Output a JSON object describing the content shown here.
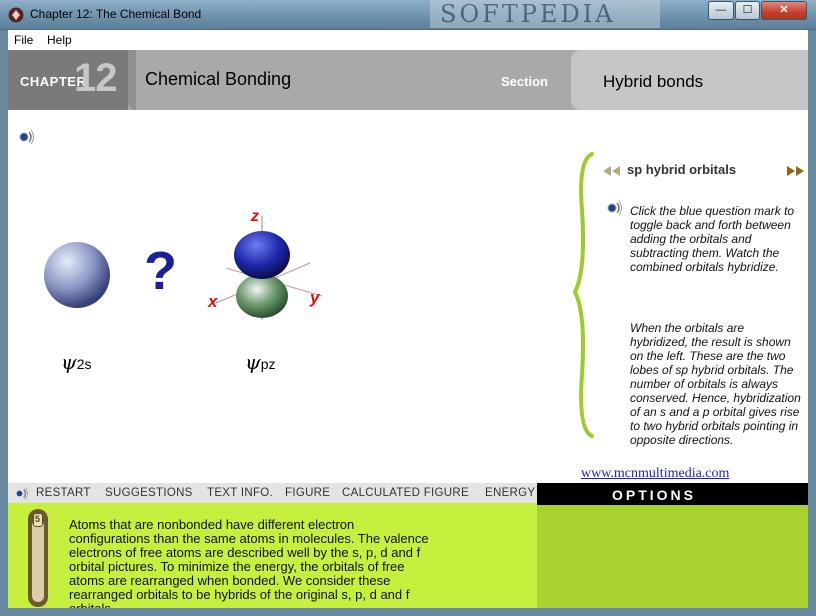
{
  "window": {
    "title": "Chapter 12: The Chemical Bond",
    "watermark": "SOFTPEDIA",
    "min_glyph": "—",
    "max_glyph": "☐",
    "close_glyph": "✕"
  },
  "menu": {
    "items": [
      "File",
      "Help"
    ]
  },
  "header": {
    "chapter_label": "CHAPTER",
    "chapter_number": "12",
    "chapter_title": "Chemical Bonding",
    "section_label": "Section",
    "section_title": "Hybrid bonds"
  },
  "stage": {
    "psi_symbol": "ψ",
    "label_2s": "2s",
    "label_pz": "pz",
    "question_mark": "?",
    "axis_z": "z",
    "axis_x": "x",
    "axis_y": "y"
  },
  "panel": {
    "title": "sp hybrid orbitals",
    "paragraph1": "Click the blue question mark to toggle back and forth between adding the orbitals and subtracting them. Watch the combined orbitals hybridize.",
    "paragraph2": "When the orbitals are hybridized, the result is shown on the left.  These are the two lobes of sp hybrid orbitals.  The number of orbitals is always conserved.  Hence, hybridization of an s and a p orbital gives rise to two hybrid orbitals pointing in opposite directions.",
    "link": "www.mcnmultimedia.com"
  },
  "toolbar": {
    "items": [
      "RESTART",
      "SUGGESTIONS",
      "TEXT INFO.",
      "FIGURE",
      "CALCULATED FIGURE",
      "ENERGY"
    ],
    "options_label": "OPTIONS"
  },
  "bottom": {
    "slider_value": "5",
    "text": "Atoms that are nonbonded have different electron configurations than the same atoms in molecules. The valence electrons of free atoms are described well by the s, p, d and f orbital pictures. To minimize the energy, the orbitals of free atoms are rearranged when bonded.  We consider these rearranged orbitals to be hybrids of the original s, p, d and f orbitals."
  },
  "colors": {
    "header_gray": "#a9a9a9",
    "question_blue": "#1a1f9c",
    "panel_bracket": "#9ccc28",
    "bottom_green": "#c6ef3e"
  }
}
